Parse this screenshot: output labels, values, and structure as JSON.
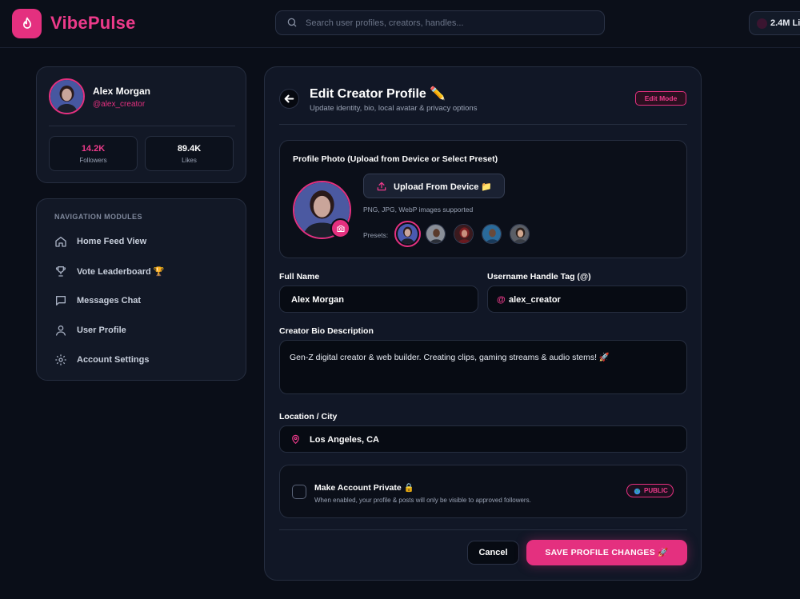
{
  "brand": {
    "name": "VibePulse",
    "accent": "#e4307f"
  },
  "search": {
    "placeholder": "Search user profiles, creators, handles..."
  },
  "live": {
    "count_label": "2.4M Li"
  },
  "profile": {
    "name": "Alex Morgan",
    "handle": "@alex_creator",
    "stats": [
      {
        "value": "14.2K",
        "label": "Followers"
      },
      {
        "value": "89.4K",
        "label": "Likes"
      }
    ]
  },
  "nav": {
    "title": "NAVIGATION MODULES",
    "items": [
      {
        "label": "Home Feed View",
        "icon": "home-icon"
      },
      {
        "label": "Vote Leaderboard 🏆",
        "icon": "trophy-icon"
      },
      {
        "label": "Messages Chat",
        "icon": "message-icon"
      },
      {
        "label": "User Profile",
        "icon": "user-icon"
      },
      {
        "label": "Account Settings",
        "icon": "gear-icon"
      }
    ]
  },
  "edit": {
    "title": "Edit Creator Profile ✏️",
    "subtitle": "Update identity, bio, local avatar & privacy options",
    "mode_badge": "Edit Mode",
    "photo": {
      "title": "Profile Photo (Upload from Device or Select Preset)",
      "upload_label": "Upload From Device 📁",
      "formats": "PNG, JPG, WebP images supported",
      "presets_label": "Presets:"
    },
    "fields": {
      "full_name_label": "Full Name",
      "full_name_value": "Alex Morgan",
      "username_label": "Username Handle Tag (@)",
      "username_prefix": "@",
      "username_value": "alex_creator",
      "bio_label": "Creator Bio Description",
      "bio_value": "Gen-Z digital creator & web builder. Creating clips, gaming streams & audio stems! 🚀",
      "location_label": "Location / City",
      "location_value": "Los Angeles, CA"
    },
    "privacy": {
      "title": "Make Account Private 🔒",
      "description": "When enabled, your profile & posts will only be visible to approved followers.",
      "badge": "PUBLIC",
      "checked": false
    },
    "actions": {
      "cancel": "Cancel",
      "save": "SAVE PROFILE CHANGES 🚀"
    }
  }
}
